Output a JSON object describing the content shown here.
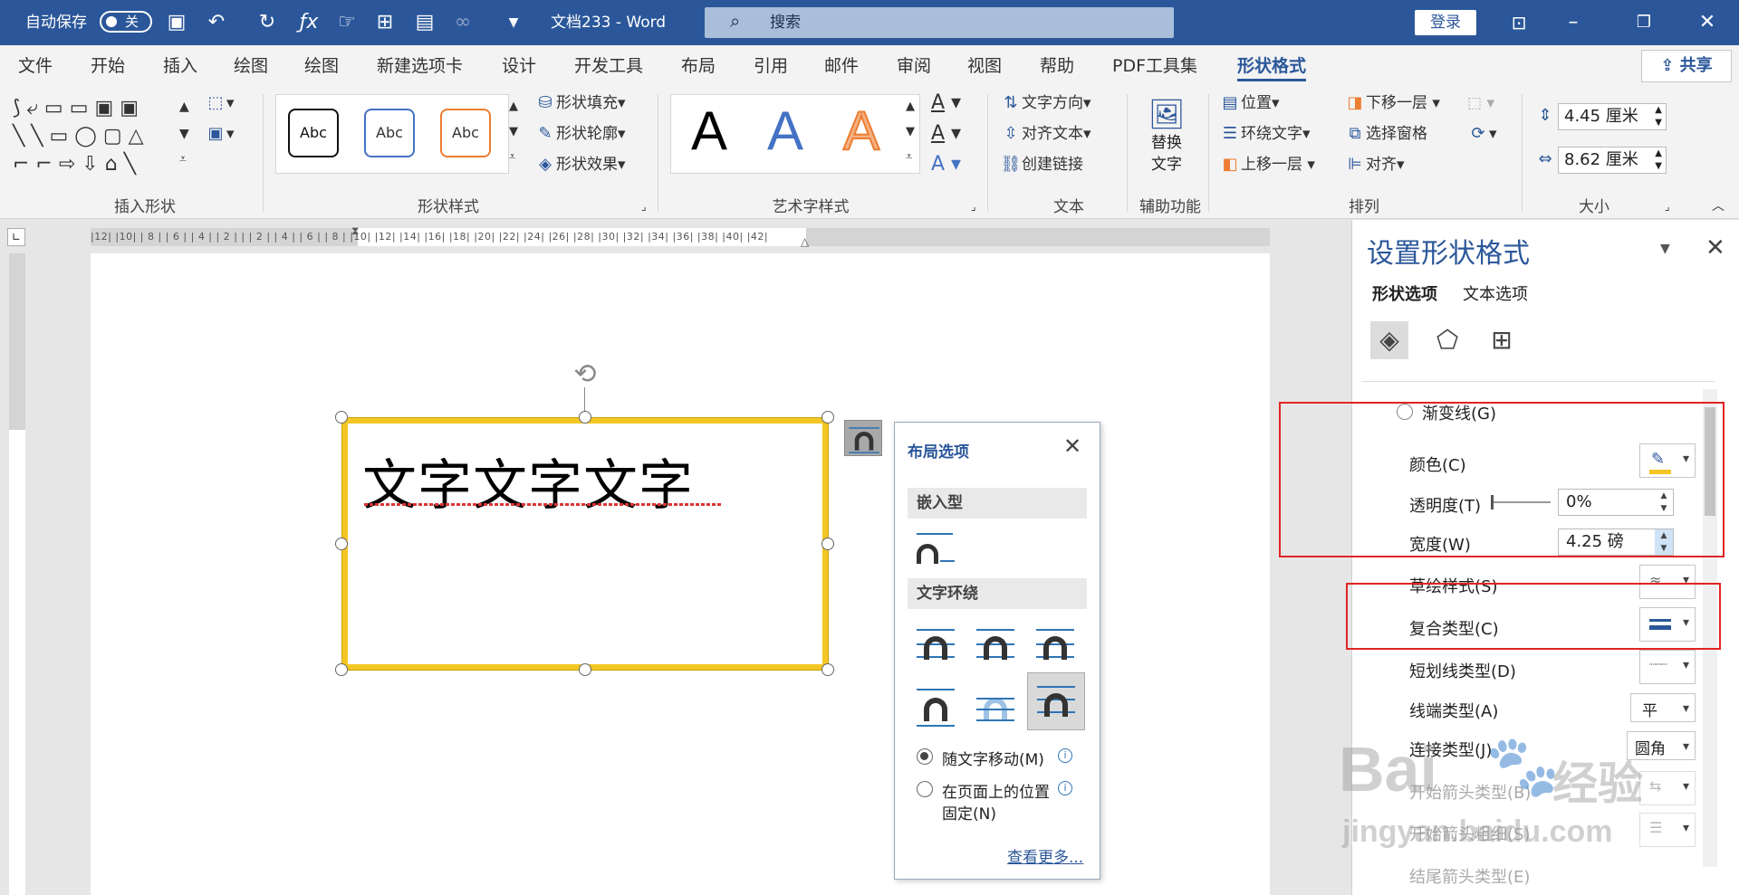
{
  "titlebar": {
    "autosave_label": "自动保存",
    "autosave_state": "关",
    "doc_title": "文档233  -  Word",
    "search_placeholder": "搜索",
    "login_label": "登录",
    "background_color": "#2b579a"
  },
  "tabs": [
    {
      "label": "文件"
    },
    {
      "label": "开始"
    },
    {
      "label": "插入"
    },
    {
      "label": "绘图"
    },
    {
      "label": "绘图"
    },
    {
      "label": "新建选项卡"
    },
    {
      "label": "设计"
    },
    {
      "label": "开发工具"
    },
    {
      "label": "布局"
    },
    {
      "label": "引用"
    },
    {
      "label": "邮件"
    },
    {
      "label": "审阅"
    },
    {
      "label": "视图"
    },
    {
      "label": "帮助"
    },
    {
      "label": "PDF工具集"
    },
    {
      "label": "形状格式"
    }
  ],
  "share_label": "共享",
  "ribbon": {
    "insert_shapes_label": "插入形状",
    "shape_styles_label": "形状样式",
    "style_abc": "Abc",
    "shape_fill": "形状填充",
    "shape_outline": "形状轮廓",
    "shape_effects": "形状效果",
    "wordart_label": "艺术字样式",
    "wordart_letter": "A",
    "text_direction": "文字方向",
    "align_text": "对齐文本",
    "create_link": "创建链接",
    "text_group_label": "文本",
    "alt_text_line1": "替换",
    "alt_text_line2": "文字",
    "accessibility_label": "辅助功能",
    "position": "位置",
    "wrap_text": "环绕文字",
    "bring_forward": "上移一层",
    "send_backward": "下移一层",
    "selection_pane": "选择窗格",
    "align": "对齐",
    "arrange_label": "排列",
    "height_value": "4.45 厘米",
    "width_value": "8.62 厘米",
    "size_label": "大小"
  },
  "ruler": {
    "numbers": "|12|  |10|  | 8 |  | 6 |  | 4 |  | 2 |     |     | 2 |  | 4 |  | 6 |  | 8 |  |10|  |12|  |14|  |16|  |18|  |20|    |22|  |24|  |26|  |28|  |30|  |32|  |34|  |36|  |38|  |40|  |42|"
  },
  "document": {
    "shape_text": "文字文字文字",
    "shape_border_color": "#f4c623"
  },
  "layout_options": {
    "title": "布局选项",
    "inline_section": "嵌入型",
    "wrap_section": "文字环绕",
    "move_with_text": "随文字移动(M)",
    "fix_position_line1": "在页面上的位置",
    "fix_position_line2": "固定(N)",
    "see_more": "查看更多..."
  },
  "pane": {
    "title": "设置形状格式",
    "tab_shape": "形状选项",
    "tab_text": "文本选项",
    "gradient_line": "渐变线(G)",
    "color_label": "颜色(C)",
    "transparency_label": "透明度(T)",
    "transparency_value": "0%",
    "width_label": "宽度(W)",
    "width_value": "4.25 磅",
    "sketch_style_label": "草绘样式(S)",
    "compound_type_label": "复合类型(C)",
    "dash_type_label": "短划线类型(D)",
    "cap_type_label": "线端类型(A)",
    "cap_type_value": "平",
    "join_type_label": "连接类型(J)",
    "join_type_value": "圆角",
    "begin_arrow_type_label": "开始箭头类型(B)",
    "begin_arrow_size_label": "开始箭头粗细(S)",
    "end_arrow_type_label": "结尾箭头类型(E)",
    "highlight_color": "#e12424",
    "accent_color": "#2b579a"
  },
  "watermark": {
    "brand": "Bai",
    "brand_suffix": "经验",
    "url": "jingyan.baidu.com"
  }
}
